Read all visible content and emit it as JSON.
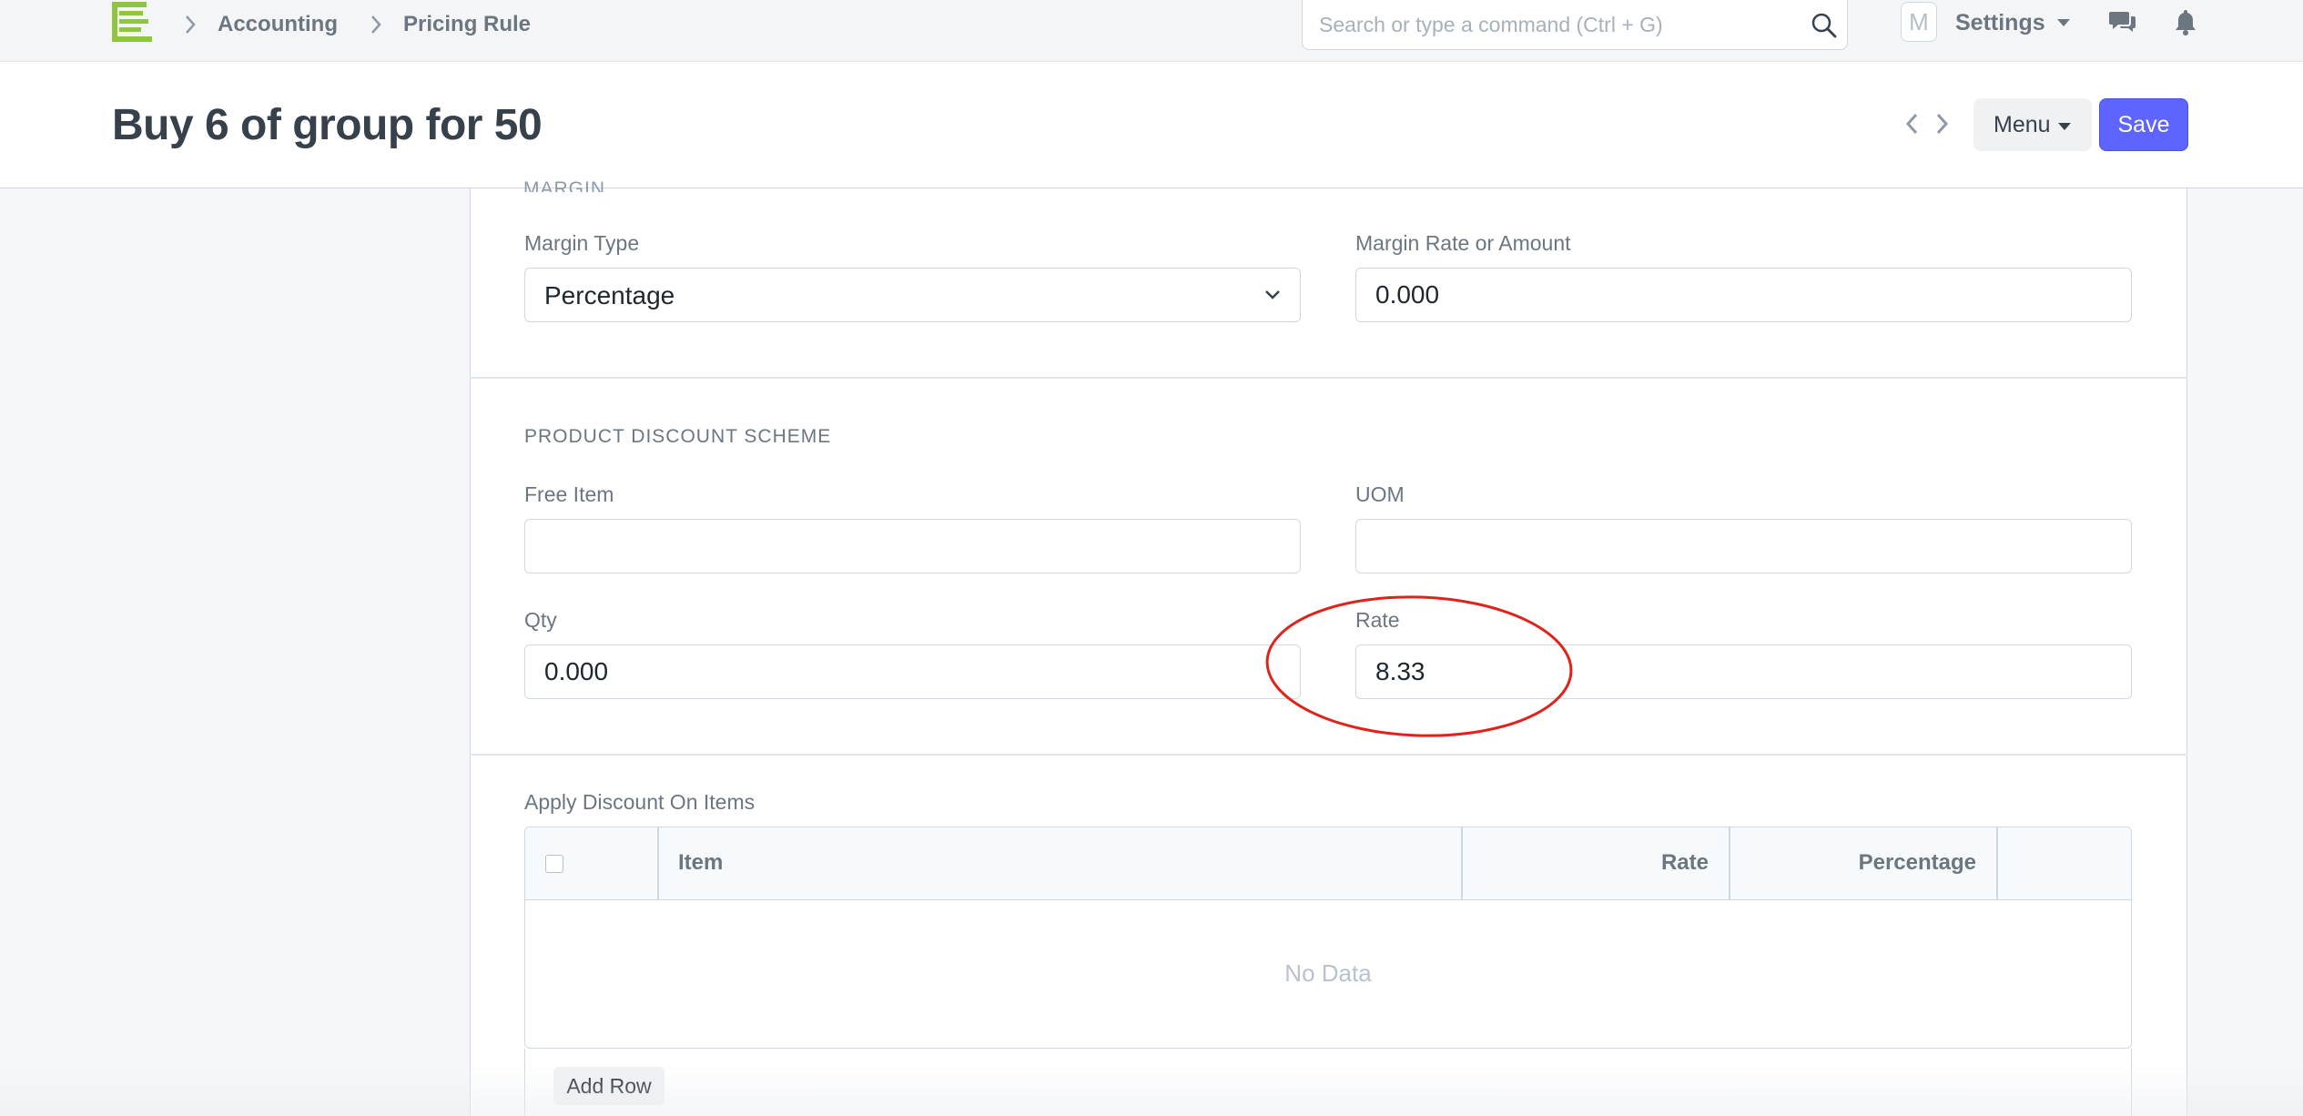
{
  "navbar": {
    "breadcrumbs": [
      "Accounting",
      "Pricing Rule"
    ],
    "search_placeholder": "Search or type a command (Ctrl + G)",
    "avatar_initial": "M",
    "settings_label": "Settings"
  },
  "page": {
    "title": "Buy 6 of group for 50",
    "menu_label": "Menu",
    "save_label": "Save"
  },
  "sections": {
    "margin": {
      "title": "MARGIN",
      "margin_type_label": "Margin Type",
      "margin_type_value": "Percentage",
      "margin_rate_label": "Margin Rate or Amount",
      "margin_rate_value": "0.000"
    },
    "product_discount": {
      "title": "PRODUCT DISCOUNT SCHEME",
      "free_item_label": "Free Item",
      "free_item_value": "",
      "uom_label": "UOM",
      "uom_value": "",
      "qty_label": "Qty",
      "qty_value": "0.000",
      "rate_label": "Rate",
      "rate_value": "8.33"
    },
    "apply_discount": {
      "label": "Apply Discount On Items",
      "columns": [
        "Item",
        "Rate",
        "Percentage"
      ],
      "empty_text": "No Data",
      "add_row_label": "Add Row"
    }
  },
  "annotation": {
    "highlight_color": "#e0221b",
    "highlighted_field": "Rate"
  },
  "colors": {
    "primary": "#5e64ff",
    "logo_green": "#8ec63f"
  }
}
